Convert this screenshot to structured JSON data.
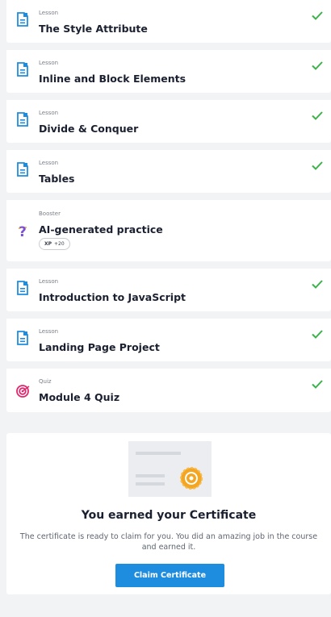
{
  "items": [
    {
      "type": "Lesson",
      "title": "The Style Attribute",
      "icon": "lesson-icon",
      "completed": true
    },
    {
      "type": "Lesson",
      "title": "Inline and Block Elements",
      "icon": "lesson-icon",
      "completed": true
    },
    {
      "type": "Lesson",
      "title": "Divide & Conquer",
      "icon": "lesson-icon",
      "completed": true
    },
    {
      "type": "Lesson",
      "title": "Tables",
      "icon": "lesson-icon",
      "completed": true
    },
    {
      "type": "Booster",
      "title": "AI-generated practice",
      "icon": "question-mark-icon",
      "completed": false,
      "xp_label": "XP",
      "xp_value": "+20"
    },
    {
      "type": "Lesson",
      "title": "Introduction to JavaScript",
      "icon": "lesson-icon",
      "completed": true
    },
    {
      "type": "Lesson",
      "title": "Landing Page Project",
      "icon": "lesson-icon",
      "completed": true
    },
    {
      "type": "Quiz",
      "title": "Module 4 Quiz",
      "icon": "target-icon",
      "completed": true
    }
  ],
  "certificate": {
    "title": "You earned your Certificate",
    "description": "The certificate is ready to claim for you. You did an amazing job in the course and earned it.",
    "button_label": "Claim Certificate"
  },
  "colors": {
    "accent": "#1e8ddf",
    "check": "#3cb24a",
    "lesson_icon": "#1e8ddf",
    "booster_icon": "#7b4fd6",
    "quiz_icon": "#e0286e",
    "badge": "#f4a623"
  }
}
